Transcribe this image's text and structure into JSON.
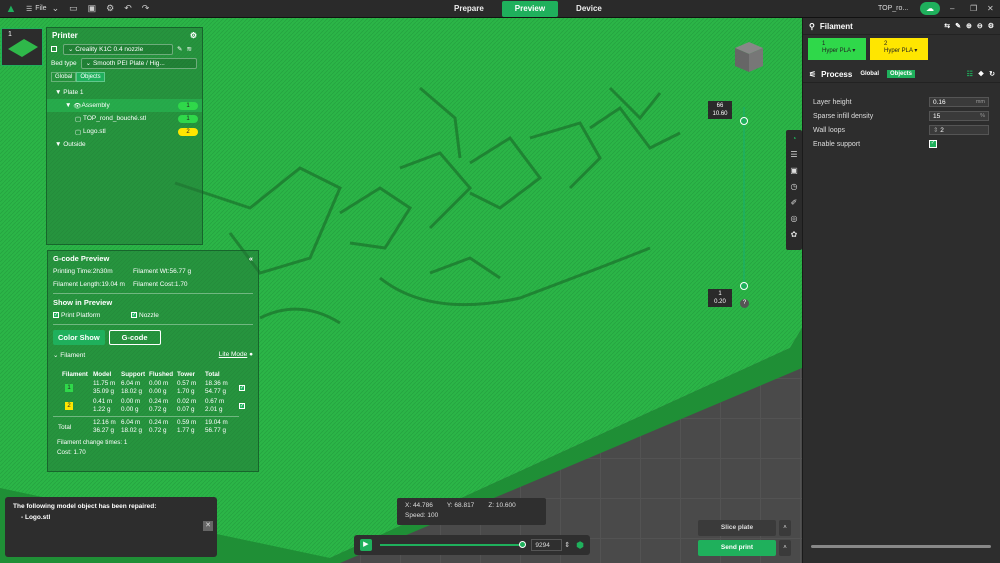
{
  "topbar": {
    "file_label": "File",
    "tabs": [
      {
        "label": "Prepare",
        "active": false
      },
      {
        "label": "Preview",
        "active": true
      },
      {
        "label": "Device",
        "active": false
      }
    ],
    "project_title": "TOP_ro..."
  },
  "plate_thumb": {
    "number": "1"
  },
  "printer_panel": {
    "title": "Printer",
    "printer_name": "Creality K1C 0.4 nozzle",
    "bed_type_label": "Bed type",
    "bed_type_value": "Smooth PEI Plate / Hig...",
    "mode_global": "Global",
    "mode_objects": "Objects",
    "tree": [
      {
        "label": "Plate 1",
        "indent": 0,
        "arrow": "▼",
        "badge": ""
      },
      {
        "label": "Assembly",
        "indent": 1,
        "arrow": "▼",
        "badge": "1",
        "selected": true
      },
      {
        "label": "TOP_rond_bouché.stl",
        "indent": 2,
        "arrow": "",
        "badge": "1"
      },
      {
        "label": "Logo.stl",
        "indent": 2,
        "arrow": "",
        "badge": "2"
      },
      {
        "label": "Outside",
        "indent": 0,
        "arrow": "▼",
        "badge": ""
      }
    ]
  },
  "gcode_panel": {
    "title": "G-code Preview",
    "printing_time": "Printing Time:2h30m",
    "filament_wt": "Filament Wt:56.77 g",
    "filament_length": "Filament Length:19.04 m",
    "filament_cost": "Filament Cost:1.70",
    "show_in_preview": "Show in Preview",
    "print_platform": "Print Platform",
    "nozzle": "Nozzle",
    "color_show": "Color Show",
    "gcode_btn": "G-code",
    "filament_dropdown": "Filament",
    "lite_mode": "Lite Mode",
    "table_headers": [
      "Filament",
      "Model",
      "Support",
      "Flushed",
      "Tower",
      "Total"
    ],
    "rows": [
      {
        "id": "1",
        "color": "#2fd84a",
        "model": [
          "11.75 m",
          "35.09 g"
        ],
        "support": [
          "6.04 m",
          "18.02 g"
        ],
        "flushed": [
          "0.00 m",
          "0.00 g"
        ],
        "tower": [
          "0.57 m",
          "1.70 g"
        ],
        "total": [
          "18.36 m",
          "54.77 g"
        ]
      },
      {
        "id": "2",
        "color": "#ffe600",
        "model": [
          "0.41 m",
          "1.22 g"
        ],
        "support": [
          "0.00 m",
          "0.00 g"
        ],
        "flushed": [
          "0.24 m",
          "0.72 g"
        ],
        "tower": [
          "0.02 m",
          "0.07 g"
        ],
        "total": [
          "0.67 m",
          "2.01 g"
        ]
      }
    ],
    "total_row": {
      "label": "Total",
      "model": [
        "12.16 m",
        "36.27 g"
      ],
      "support": [
        "6.04 m",
        "18.02 g"
      ],
      "flushed": [
        "0.24 m",
        "0.72 g"
      ],
      "tower": [
        "0.59 m",
        "1.77 g"
      ],
      "total": [
        "19.04 m",
        "56.77 g"
      ]
    },
    "change_times": "Filament change times:  1",
    "cost": "Cost:  1.70"
  },
  "notification": {
    "line1": "The following model object has been repaired:",
    "line2": "- Logo.stl"
  },
  "coords": {
    "x": "X: 44.786",
    "y": "Y: 68.817",
    "z": "Z: 10.600",
    "speed": "Speed: 100"
  },
  "playbar": {
    "layer_value": "9294"
  },
  "slice": {
    "slice_label": "Slice plate",
    "send_label": "Send print"
  },
  "layer_slider": {
    "top_layer": "66",
    "top_height": "10.60",
    "bottom_layer": "1",
    "bottom_height": "0.20"
  },
  "cube": {
    "top": "Top",
    "front": "Front"
  },
  "right_panel": {
    "filament_title": "Filament",
    "filaments": [
      {
        "id": "1",
        "name": "Hyper PLA",
        "color": "#2fd84a"
      },
      {
        "id": "2",
        "name": "Hyper PLA",
        "color": "#ffe600"
      }
    ],
    "process_title": "Process",
    "mode_global": "Global",
    "mode_objects": "Objects",
    "params": [
      {
        "label": "Layer height",
        "value": "0.16",
        "unit": "mm"
      },
      {
        "label": "Sparse infill density",
        "value": "15",
        "unit": "%"
      },
      {
        "label": "Wall loops",
        "value": "2",
        "unit": ""
      },
      {
        "label": "Enable support",
        "value": "",
        "unit": ""
      }
    ]
  },
  "colors": {
    "accent": "#1fb05c",
    "model_green": "#2fb84a",
    "filament2": "#ffe600"
  }
}
